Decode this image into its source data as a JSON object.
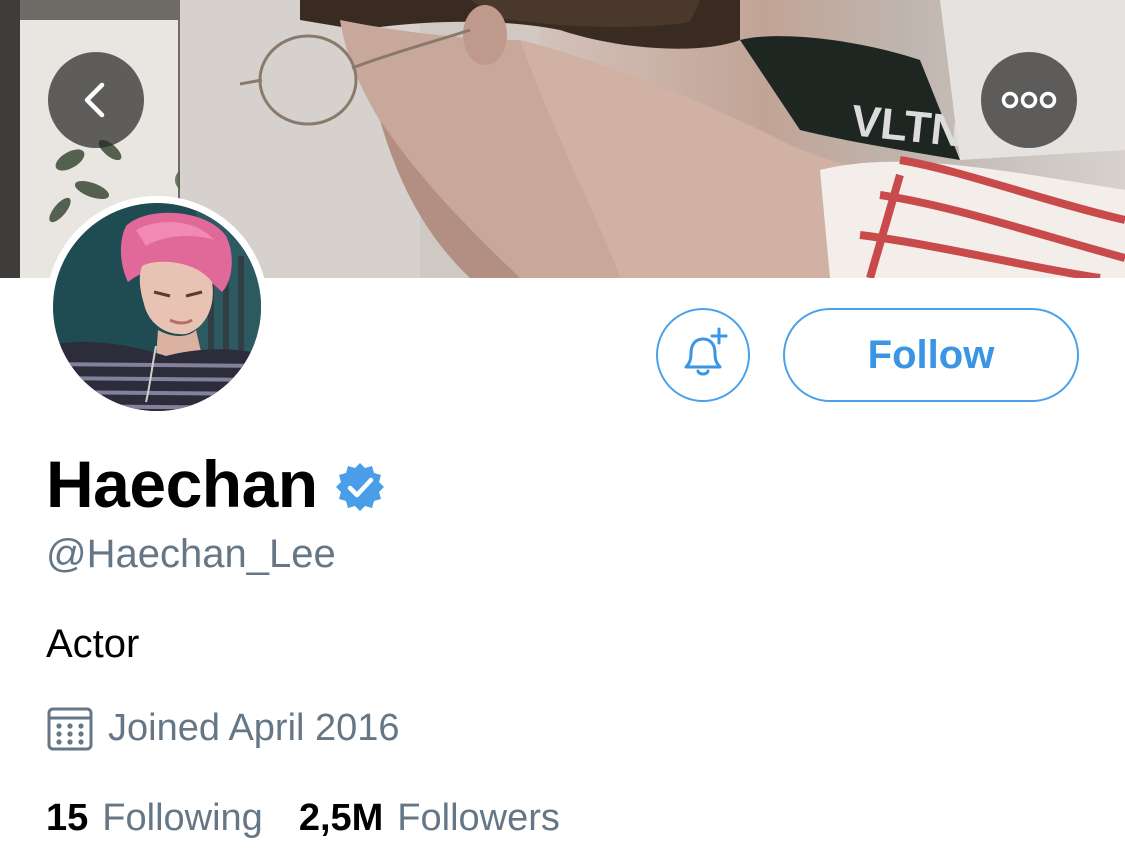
{
  "colors": {
    "accent": "#3a95e4",
    "secondary_text": "#657786",
    "primary_text": "#000000",
    "verified_badge": "#4a9de8"
  },
  "header": {
    "back_icon": "chevron-left-icon",
    "more_icon": "more-horizontal-icon"
  },
  "profile": {
    "display_name": "Haechan",
    "verified": true,
    "handle": "@Haechan_Lee",
    "bio": "Actor",
    "joined_icon": "calendar-icon",
    "joined": "Joined April 2016"
  },
  "actions": {
    "notify_icon": "bell-plus-icon",
    "follow_label": "Follow"
  },
  "stats": {
    "following_count": "15",
    "following_label": "Following",
    "followers_count": "2,5M",
    "followers_label": "Followers"
  }
}
